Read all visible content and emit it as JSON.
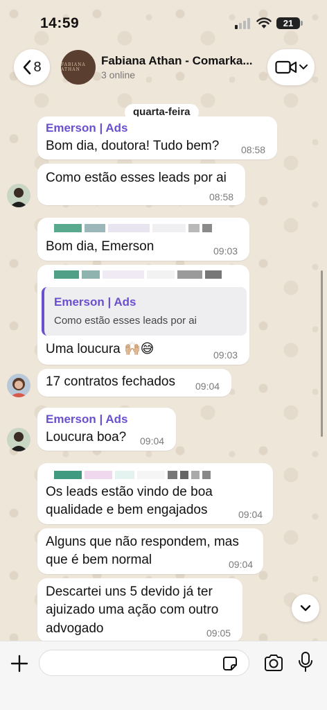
{
  "status_bar": {
    "time": "14:59",
    "battery": "21"
  },
  "header": {
    "back_count": "8",
    "title": "Fabiana Athan - Comarka...",
    "subtitle": "3 online",
    "group_avatar_text": "FABIANA ATHAN"
  },
  "day_label": "quarta-feira",
  "messages": [
    {
      "sender": "Emerson | Ads",
      "text": "Bom dia, doutora! Tudo bem?",
      "time": "08:58"
    },
    {
      "text": "Como estão esses leads por ai",
      "time": "08:58"
    },
    {
      "text": "Bom dia, Emerson",
      "time": "09:03"
    },
    {
      "quote_sender": "Emerson | Ads",
      "quote_text": "Como estão esses leads por ai",
      "text": "Uma loucura 🙌🏼😅",
      "time": "09:03"
    },
    {
      "text": "17 contratos fechados",
      "time": "09:04"
    },
    {
      "sender": "Emerson | Ads",
      "text": "Loucura boa?",
      "time": "09:04"
    },
    {
      "text_line1": "Os leads estão vindo de boa",
      "text_line2": "qualidade e bem engajados",
      "time": "09:04"
    },
    {
      "text_line1": "Alguns que não respondem, mas",
      "text_line2": "que é bem normal",
      "time": "09:04"
    },
    {
      "text_line1": "Descartei uns 5 devido já ter",
      "text_line2": "ajuizado uma ação com outro",
      "text_line3": "advogado",
      "time": "09:05"
    }
  ],
  "composer": {
    "placeholder": ""
  },
  "colors": {
    "sender_name": "#6a4fcf",
    "chat_background": "#efe6da",
    "bubble": "#ffffff"
  }
}
